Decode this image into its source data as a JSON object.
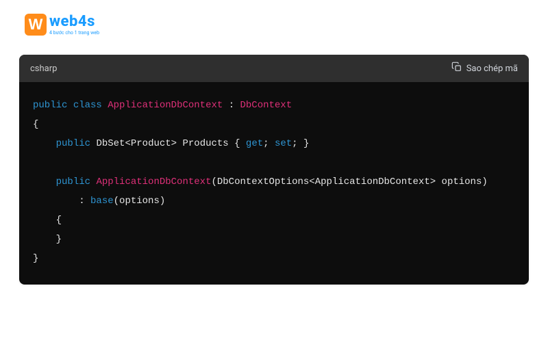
{
  "logo": {
    "icon_letter": "W",
    "text": "web4s",
    "tagline": "4 bước cho 1 trang web"
  },
  "code_header": {
    "language": "csharp",
    "copy_label": "Sao chép mã"
  },
  "code": {
    "tokens": {
      "public": "public",
      "class": "class",
      "AppDbContext": "ApplicationDbContext",
      "DbContext": "DbContext",
      "DbSet": "DbSet",
      "Product": "Product",
      "Products": "Products",
      "get": "get",
      "set": "set",
      "DbContextOptions": "DbContextOptions",
      "options": "options",
      "base": "base"
    }
  }
}
